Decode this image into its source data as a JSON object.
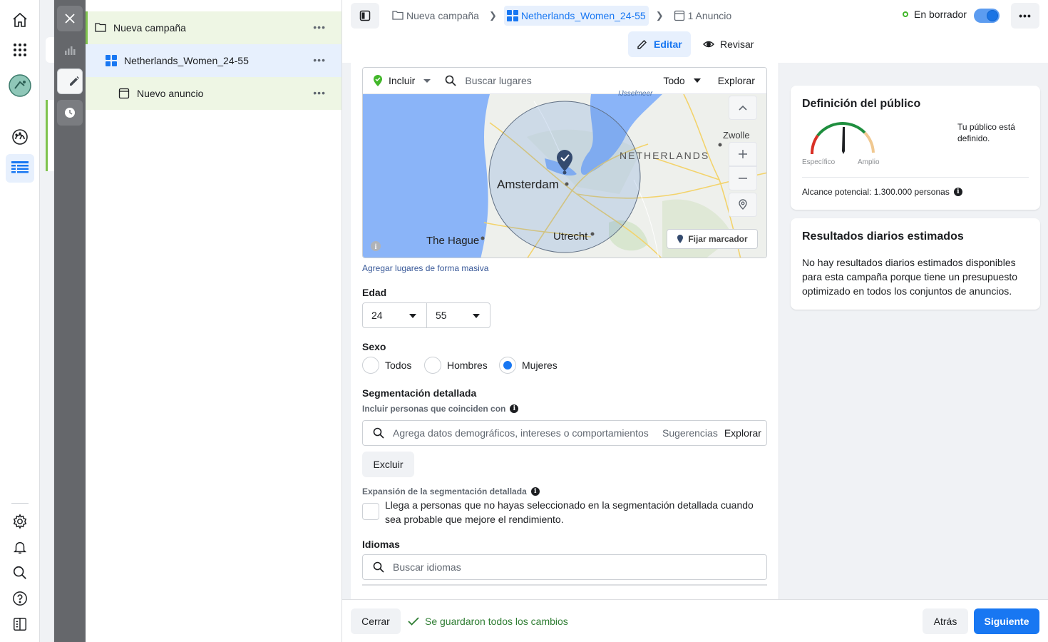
{
  "global_nav": {
    "icons": [
      "home-icon",
      "apps-grid-icon",
      "account-avatar",
      "dashboard-gauge-icon",
      "ads-manager-table-icon",
      "settings-gear-icon",
      "notifications-bell-icon",
      "search-icon",
      "help-icon",
      "panel-toggle-icon"
    ]
  },
  "tree": {
    "campaign": "Nueva campaña",
    "adset": "Netherlands_Women_24-55",
    "ad": "Nuevo anuncio",
    "more": "•••"
  },
  "topbar": {
    "breadcrumbs": [
      {
        "label": "Nueva campaña"
      },
      {
        "label": "Netherlands_Women_24-55"
      },
      {
        "label": "1 Anuncio"
      }
    ],
    "status_label": "En borrador",
    "toggle_on": true,
    "more": "•••",
    "tabs": {
      "edit": "Editar",
      "review": "Revisar"
    }
  },
  "location": {
    "include_label": "Incluir",
    "search_placeholder": "Buscar lugares",
    "filter_label": "Todo",
    "explore_label": "Explorar",
    "map_labels": {
      "country": "NETHERLANDS",
      "amsterdam": "Amsterdam",
      "utrecht": "Utrecht",
      "the_hague": "The Hague",
      "zwolle": "Zwolle",
      "ijsselmeer": "IJsselmeer"
    },
    "pin_button": "Fijar marcador",
    "bulk_link": "Agregar lugares de forma masiva"
  },
  "age": {
    "label": "Edad",
    "min": "24",
    "max": "55"
  },
  "gender": {
    "label": "Sexo",
    "options": [
      "Todos",
      "Hombres",
      "Mujeres"
    ],
    "selected": "Mujeres"
  },
  "detailed_targeting": {
    "label": "Segmentación detallada",
    "sublabel": "Incluir personas que coinciden con",
    "placeholder": "Agrega datos demográficos, intereses o comportamientos",
    "suggestions": "Sugerencias",
    "explore": "Explorar",
    "exclude_button": "Excluir",
    "expansion_label": "Expansión de la segmentación detallada",
    "expansion_text": "Llega a personas que no hayas seleccionado en la segmentación detallada cuando sea probable que mejore el rendimiento.",
    "expansion_checked": false
  },
  "languages": {
    "label": "Idiomas",
    "placeholder": "Buscar idiomas"
  },
  "audience_definition": {
    "title": "Definición del público",
    "status": "Tu público está definido.",
    "specific": "Específico",
    "broad": "Amplio",
    "reach": "Alcance potencial: 1.300.000 personas"
  },
  "daily_results": {
    "title": "Resultados diarios estimados",
    "text": "No hay resultados diarios estimados disponibles para esta campaña porque tiene un presupuesto optimizado en todos los conjuntos de anuncios."
  },
  "footer": {
    "close": "Cerrar",
    "saved": "Se guardaron todos los cambios",
    "back": "Atrás",
    "next": "Siguiente"
  },
  "colors": {
    "accent": "#1877f2",
    "selected_row": "#e7f0fd",
    "campaign_row": "#eef6e4",
    "success": "#42b72a"
  }
}
